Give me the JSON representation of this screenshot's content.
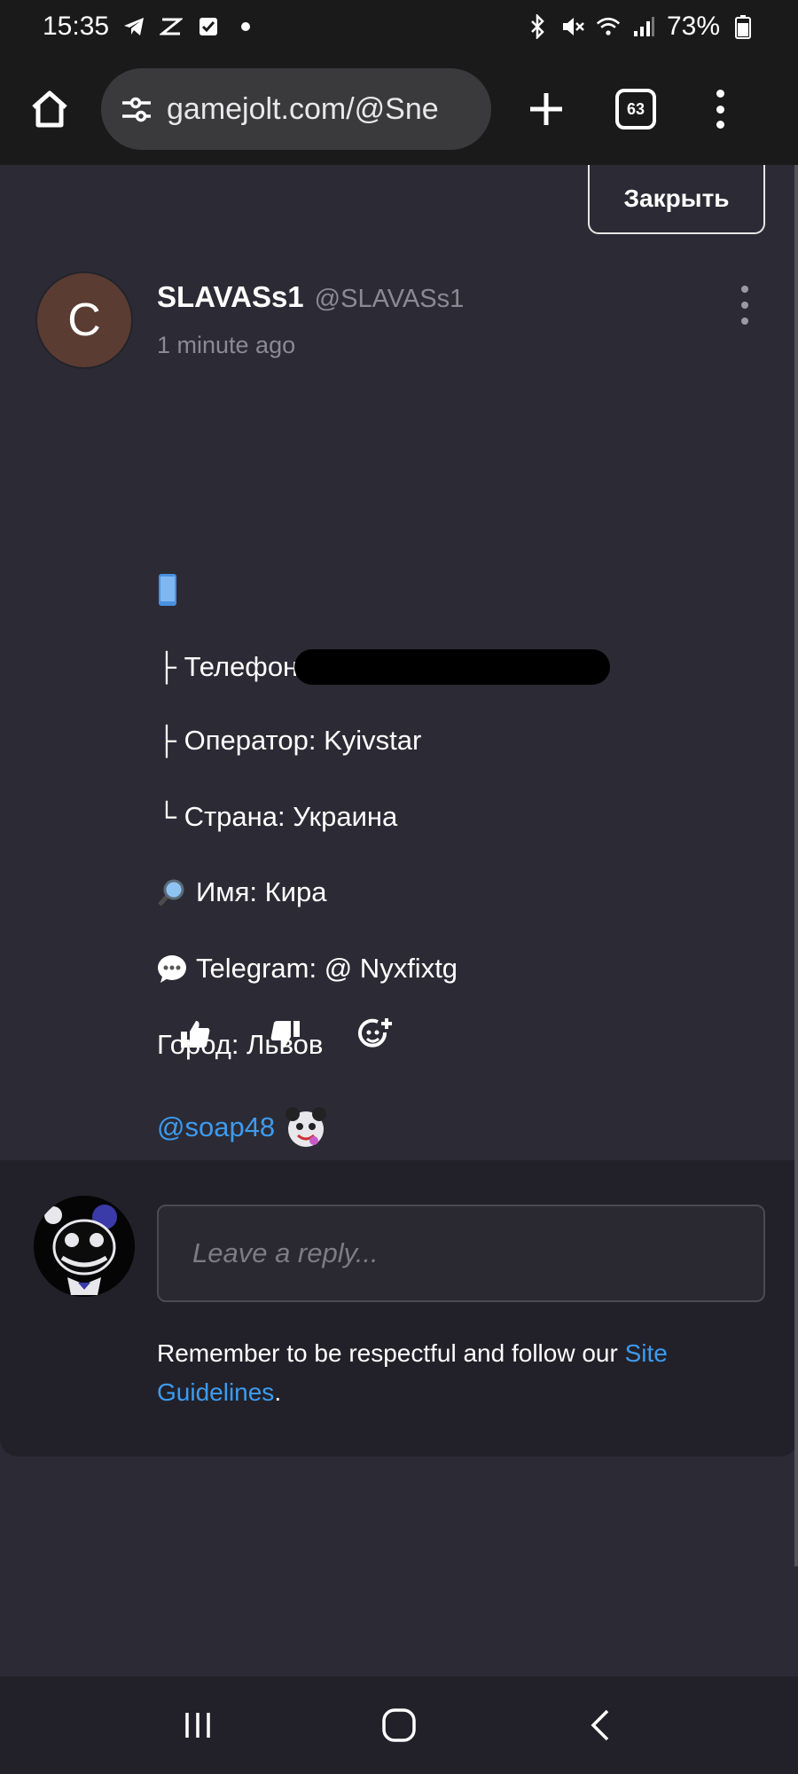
{
  "status_bar": {
    "time": "15:35",
    "left_icons": [
      "telegram-icon",
      "capcut-icon",
      "checkbox-icon",
      "dot-icon"
    ],
    "right_icons": [
      "bluetooth-icon",
      "mute-icon",
      "wifi-icon",
      "signal-icon"
    ],
    "battery": "73%"
  },
  "browser": {
    "url": "gamejolt.com/@Sne",
    "tab_count": "63"
  },
  "close_button": "Закрыть",
  "post": {
    "author_initial": "C",
    "author_name": "SLAVASs1",
    "author_handle": "@SLAVASs1",
    "timestamp": "1 minute ago",
    "lines": {
      "phone": "├ Телефон",
      "operator": "├ Оператор: Kyivstar",
      "country": "└ Страна: Украина",
      "name": "Имя: Кира",
      "telegram": "Telegram: @ Nyxfixtg",
      "city": "Город: Львов",
      "mention": "@soap48"
    }
  },
  "reply": {
    "placeholder": "Leave a reply...",
    "note_prefix": "Remember to be respectful and follow our ",
    "link_text": "Site Guidelines",
    "note_suffix": "."
  },
  "colors": {
    "background": "#2c2b35",
    "panel": "#222129",
    "link": "#3d9bf0",
    "muted": "#8b8a92"
  }
}
